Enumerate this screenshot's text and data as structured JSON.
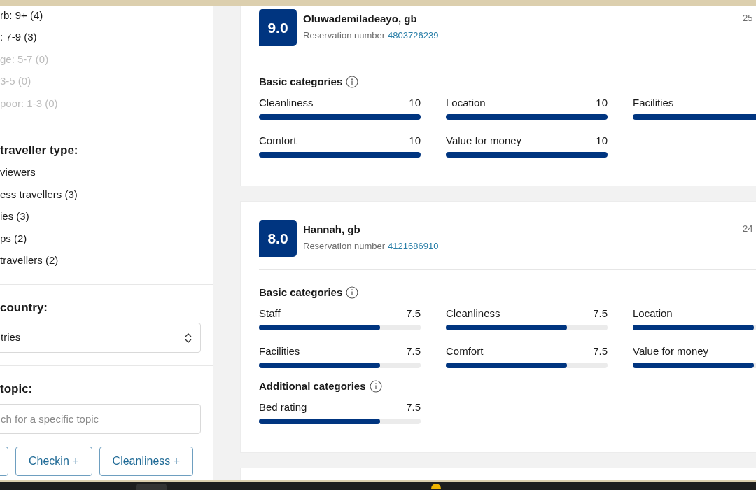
{
  "sidebar": {
    "sections": [
      {
        "items": [
          {
            "label": "rb: 9+ (4)",
            "disabled": false
          },
          {
            "label": ": 7-9 (3)",
            "disabled": false
          },
          {
            "label": "ge: 5-7 (0)",
            "disabled": true
          },
          {
            "label": "3-5 (0)",
            "disabled": true
          },
          {
            "label": "poor: 1-3 (0)",
            "disabled": true
          }
        ]
      },
      {
        "heading": "traveller type:",
        "items": [
          {
            "label": "viewers",
            "disabled": false
          },
          {
            "label": "ess travellers (3)",
            "disabled": false
          },
          {
            "label": "ies (3)",
            "disabled": false
          },
          {
            "label": "ps (2)",
            "disabled": false
          },
          {
            "label": "travellers (2)",
            "disabled": false
          }
        ]
      },
      {
        "heading": "country:",
        "select": {
          "value": "tries"
        }
      },
      {
        "heading": "topic:",
        "input": {
          "placeholder": "ch for a specific topic"
        },
        "topics": [
          {
            "kind": "cut"
          },
          {
            "label": "Checkin",
            "icon": "+"
          },
          {
            "label": "Cleanliness",
            "icon": "+"
          }
        ]
      }
    ]
  },
  "reviews": [
    {
      "score": "9.0",
      "name": "Oluwademiladeayo, gb",
      "reservation_label": "Reservation number",
      "reservation_number": "4803726239",
      "date": "25",
      "groups": [
        {
          "title": "Basic categories",
          "categories": [
            {
              "label": "Cleanliness",
              "value": "10",
              "level": 1
            },
            {
              "label": "Location",
              "value": "10",
              "level": 1
            },
            {
              "label": "Facilities",
              "level": 1
            },
            {
              "label": "Comfort",
              "value": "10",
              "level": 1
            },
            {
              "label": "Value for money",
              "value": "10",
              "level": 1
            }
          ]
        }
      ]
    },
    {
      "score": "8.0",
      "name": "Hannah, gb",
      "reservation_label": "Reservation number",
      "reservation_number": "4121686910",
      "date": "24",
      "groups": [
        {
          "title": "Basic categories",
          "categories": [
            {
              "label": "Staff",
              "value": "7.5",
              "level": 0.75
            },
            {
              "label": "Cleanliness",
              "value": "7.5",
              "level": 0.75
            },
            {
              "label": "Location",
              "level": 0.75
            },
            {
              "label": "Facilities",
              "value": "7.5",
              "level": 0.75
            },
            {
              "label": "Comfort",
              "value": "7.5",
              "level": 0.75
            },
            {
              "label": "Value for money",
              "level": 0.75
            }
          ]
        },
        {
          "title": "Additional categories",
          "categories": [
            {
              "label": "Bed rating",
              "value": "7.5",
              "level": 0.75
            }
          ]
        }
      ]
    }
  ]
}
